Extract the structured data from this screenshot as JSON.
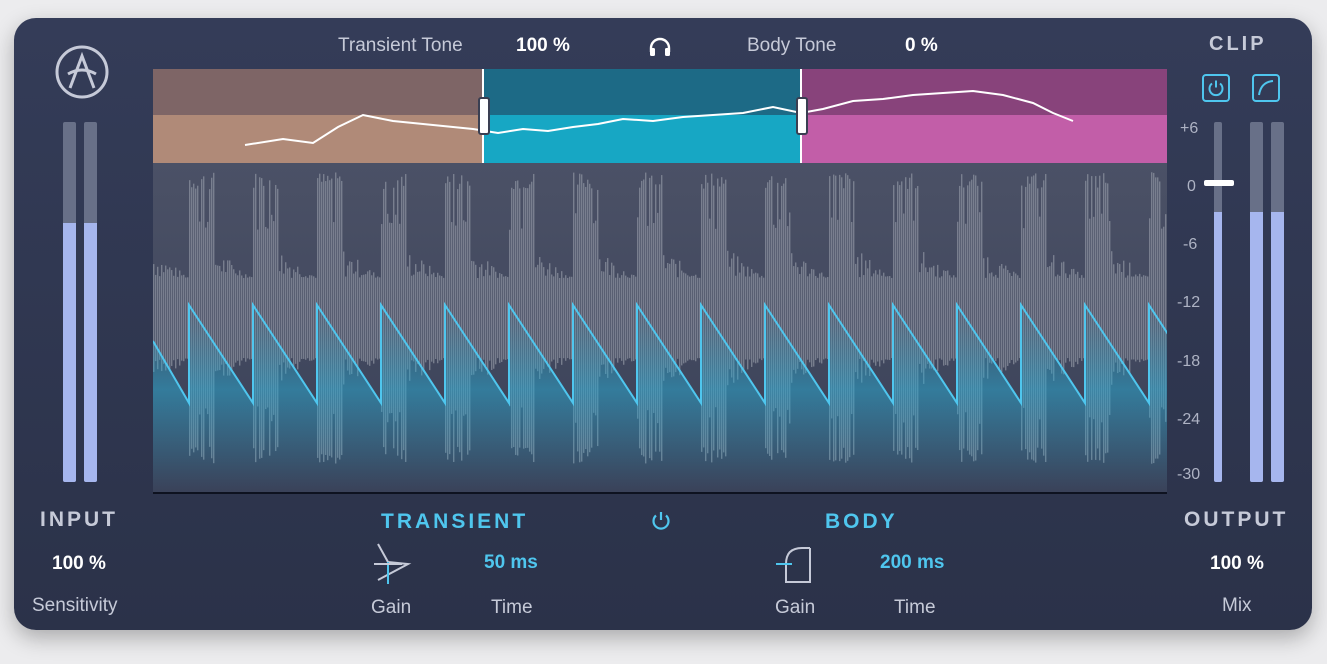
{
  "header": {
    "transient_tone_label": "Transient Tone",
    "transient_tone_value": "100 %",
    "body_tone_label": "Body Tone",
    "body_tone_value": "0 %",
    "headphone_icon": "headphones-icon"
  },
  "logo": {
    "icon": "arturia-logo-icon"
  },
  "clip": {
    "label": "CLIP",
    "power_icon": "power-icon",
    "curve_icon": "clip-curve-icon"
  },
  "input": {
    "label": "INPUT",
    "value": "100 %",
    "param_label": "Sensitivity",
    "meter_left_level": 0.72,
    "meter_right_level": 0.72
  },
  "output": {
    "label": "OUTPUT",
    "value": "100 %",
    "param_label": "Mix",
    "meter_left_level": 0.75,
    "meter_right_level": 0.75,
    "gain_meter_level": 0.75
  },
  "scale": [
    "+6",
    "0",
    "-6",
    "-12",
    "-18",
    "-24",
    "-30"
  ],
  "transient": {
    "title": "TRANSIENT",
    "gain_label": "Gain",
    "time_label": "Time",
    "time_value": "50 ms",
    "gain_icon": "transient-shape-icon"
  },
  "body": {
    "title": "BODY",
    "gain_label": "Gain",
    "time_label": "Time",
    "time_value": "200 ms",
    "gain_icon": "body-shape-icon"
  },
  "center_power_icon": "power-icon",
  "colors": {
    "accent": "#4fc6ee",
    "band_low": "#b08a78",
    "band_mid": "#17a7c4",
    "band_high": "#c25ea8",
    "panel": "#2f3650"
  }
}
